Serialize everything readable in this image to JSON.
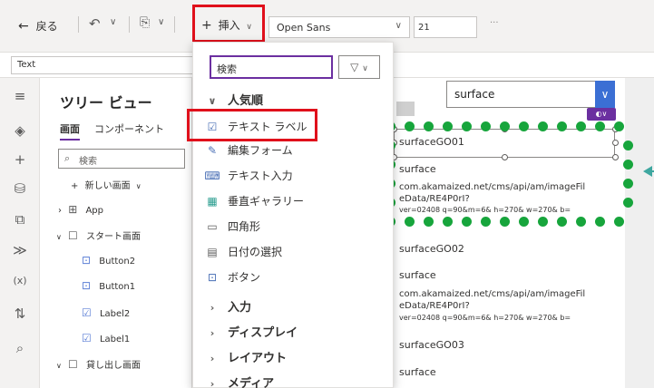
{
  "toolbar": {
    "back_label": "戻る",
    "insert_label": "挿入",
    "font_name": "Open Sans",
    "font_size": "21",
    "more": "···"
  },
  "formula": {
    "property": "Text"
  },
  "tree": {
    "title": "ツリー ビュー",
    "tab_screens": "画面",
    "tab_components": "コンポーネント",
    "search_placeholder": "検索",
    "new_screen": "新しい画面",
    "items": [
      {
        "label": "App"
      },
      {
        "label": "スタート画面"
      },
      {
        "label": "Button2"
      },
      {
        "label": "Button1"
      },
      {
        "label": "Label2"
      },
      {
        "label": "Label1"
      },
      {
        "label": "貸し出し画面"
      }
    ]
  },
  "menu": {
    "search_value": "検索",
    "popular_label": "人気順",
    "items": [
      {
        "label": "テキスト ラベル",
        "icon": "text-label-icon"
      },
      {
        "label": "編集フォーム",
        "icon": "edit-form-icon"
      },
      {
        "label": "テキスト入力",
        "icon": "text-input-icon"
      },
      {
        "label": "垂直ギャラリー",
        "icon": "vertical-gallery-icon"
      },
      {
        "label": "四角形",
        "icon": "rectangle-icon"
      },
      {
        "label": "日付の選択",
        "icon": "date-picker-icon"
      },
      {
        "label": "ボタン",
        "icon": "button-icon"
      }
    ],
    "categories": [
      {
        "label": "入力"
      },
      {
        "label": "ディスプレイ"
      },
      {
        "label": "レイアウト"
      },
      {
        "label": "メディア"
      }
    ]
  },
  "canvas": {
    "dropdown_value": "surface",
    "gallery": [
      {
        "title": "surfaceGO01",
        "sub": "surface",
        "url1": "com.akamaized.net/cms/api/am/imageFil",
        "url2": "eData/RE4P0rI?",
        "url3": "ver=02408 q=90&m=6& h=270& w=270& b="
      },
      {
        "title": "surfaceGO02",
        "sub": "surface",
        "url1": "com.akamaized.net/cms/api/am/imageFil",
        "url2": "eData/RE4P0rI?",
        "url3": "ver=02408 q=90&m=6& h=270& w=270& b="
      },
      {
        "title": "surfaceGO03",
        "sub": "surface"
      }
    ]
  },
  "colors": {
    "accent": "#6b2fa0",
    "highlight_red": "#e0101b",
    "dot_green": "#17a53c",
    "dropdown_blue": "#3b6fd4"
  }
}
